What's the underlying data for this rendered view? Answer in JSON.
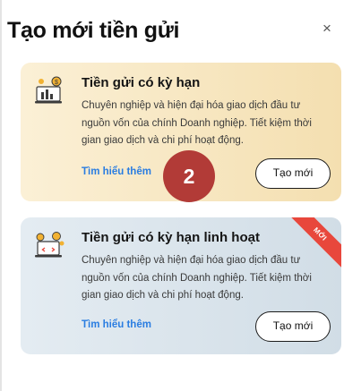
{
  "dialog": {
    "title": "Tạo mới tiền gửi",
    "close_symbol": "×"
  },
  "cards": [
    {
      "title": "Tiền gửi có kỳ hạn",
      "description": "Chuyên nghiệp và hiện đại hóa giao dịch đầu tư nguồn vốn của chính Doanh nghiệp. Tiết kiệm thời gian giao dịch và chi phí hoạt động.",
      "learn_more": "Tìm hiểu thêm",
      "create_label": "Tạo mới",
      "icon": "term-deposit-icon",
      "background": "#f6e4b9"
    },
    {
      "title": "Tiền gửi có kỳ hạn linh hoạt",
      "description": "Chuyên nghiệp và hiện đại hóa giao dịch đầu tư nguồn vốn của chính Doanh nghiệp. Tiết kiệm thời gian giao dịch và chi phí hoạt động.",
      "learn_more": "Tìm hiểu thêm",
      "create_label": "Tạo mới",
      "icon": "flexible-deposit-icon",
      "ribbon": "MỚI",
      "background": "#d8e3eb"
    }
  ],
  "step_badge": "2",
  "colors": {
    "link": "#2a7de1",
    "badge": "#b23b37",
    "ribbon": "#e8473c"
  }
}
